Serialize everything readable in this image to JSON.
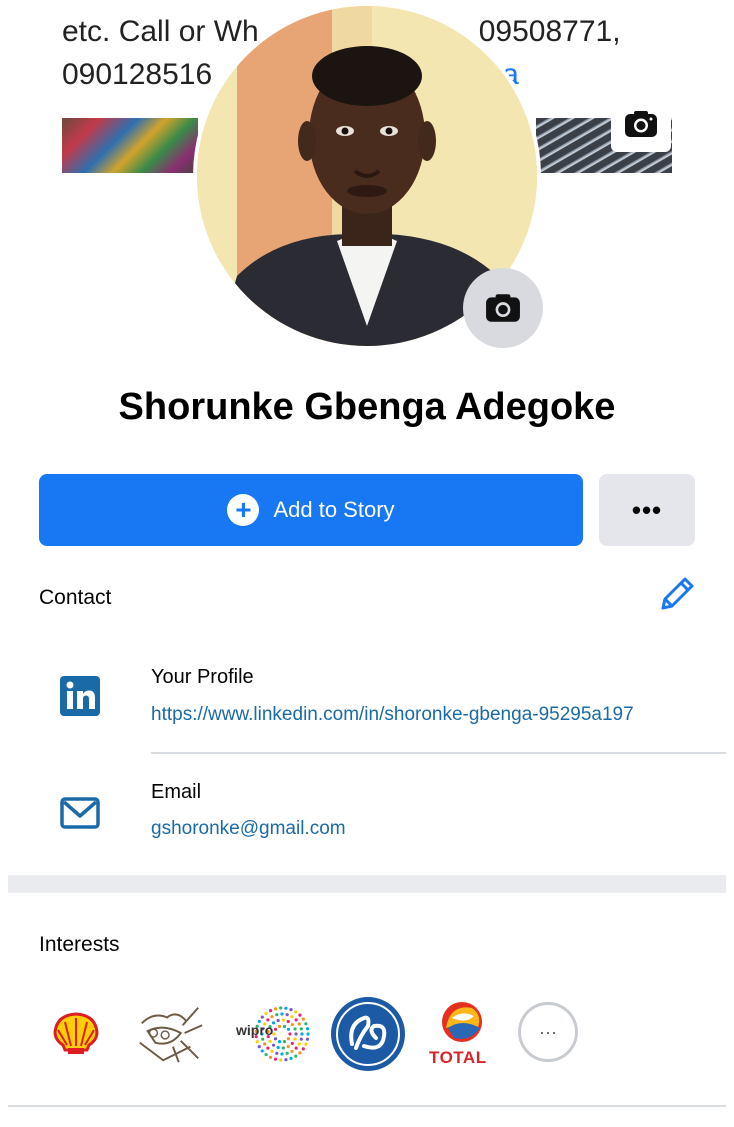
{
  "cover": {
    "text_line1": "etc. Call or Wh",
    "text_line1_tail": "09508771,",
    "text_line2": "090128516",
    "text_line2_tail": "a"
  },
  "profile": {
    "name": "Shorunke Gbenga Adegoke"
  },
  "actions": {
    "add_story_label": "Add to Story",
    "more_label": "•••"
  },
  "contact": {
    "title": "Contact",
    "items": [
      {
        "icon": "linkedin-icon",
        "label": "Your Profile",
        "value": "https://www.linkedin.com/in/shoronke-gbenga-95295a197"
      },
      {
        "icon": "mail-icon",
        "label": "Email",
        "value": "gshoronke@gmail.com"
      }
    ]
  },
  "interests": {
    "title": "Interests",
    "items": [
      {
        "icon": "shell-logo-icon"
      },
      {
        "icon": "nestle-logo-icon"
      },
      {
        "icon": "wipro-logo-icon",
        "text": "wipro"
      },
      {
        "icon": "ge-logo-icon"
      },
      {
        "icon": "total-logo-icon",
        "text": "TOTAL"
      }
    ],
    "more_label": "···"
  },
  "colors": {
    "accent": "#1877f2",
    "link": "#1b6aa8",
    "secondary_button": "#e4e6eb",
    "ge_blue": "#1c5aa6",
    "total_red": "#d7262b"
  }
}
